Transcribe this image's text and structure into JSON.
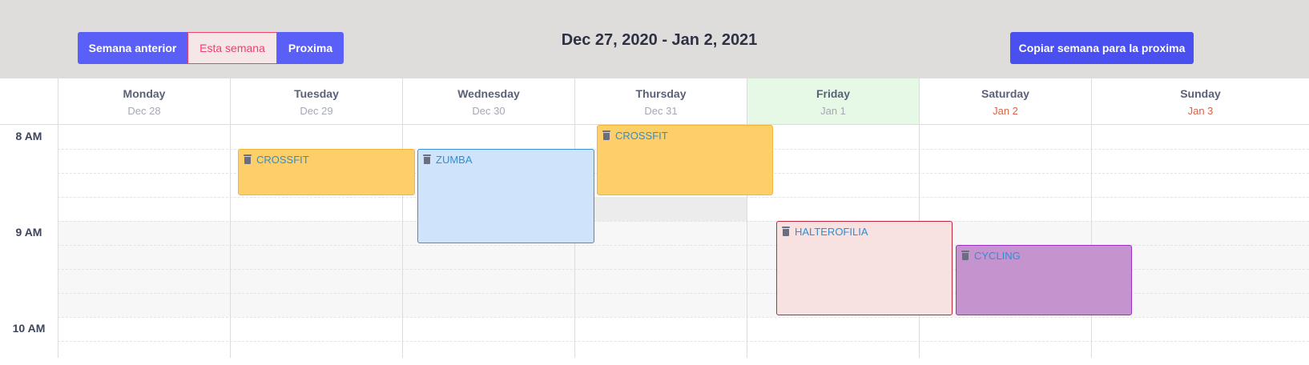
{
  "toolbar": {
    "prev_label": "Semana anterior",
    "this_label": "Esta semana",
    "next_label": "Proxima",
    "date_range": "Dec 27, 2020 - Jan 2, 2021",
    "copy_label": "Copiar semana para la proxima"
  },
  "days": [
    {
      "name": "Monday",
      "date": "Dec 28"
    },
    {
      "name": "Tuesday",
      "date": "Dec 29"
    },
    {
      "name": "Wednesday",
      "date": "Dec 30"
    },
    {
      "name": "Thursday",
      "date": "Dec 31"
    },
    {
      "name": "Friday",
      "date": "Jan 1"
    },
    {
      "name": "Saturday",
      "date": "Jan 2"
    },
    {
      "name": "Sunday",
      "date": "Jan 3"
    }
  ],
  "times": [
    "8 AM",
    "9 AM",
    "10 AM"
  ],
  "events": [
    {
      "title": "CROSSFIT",
      "day": "Tuesday",
      "start": "8:15",
      "end": "9:00"
    },
    {
      "title": "ZUMBA",
      "day": "Wednesday",
      "start": "8:15",
      "end": "9:15"
    },
    {
      "title": "CROSSFIT",
      "day": "Thursday",
      "start": "8:00",
      "end": "8:45"
    },
    {
      "title": "HALTEROFILIA",
      "day": "Friday",
      "start": "9:00",
      "end": "10:00"
    },
    {
      "title": "CYCLING",
      "day": "Saturday",
      "start": "9:15",
      "end": "10:00"
    }
  ],
  "colors": {
    "primary": "#5a5ff7",
    "active": "#ef3f6b",
    "today_bg": "#e6f9e7",
    "weekend_date": "#d9624a",
    "event_yellow": "#fdcf6a",
    "event_blue": "#cfe4fb",
    "event_pink": "#f7e1e1",
    "event_purple": "#c593cd"
  }
}
